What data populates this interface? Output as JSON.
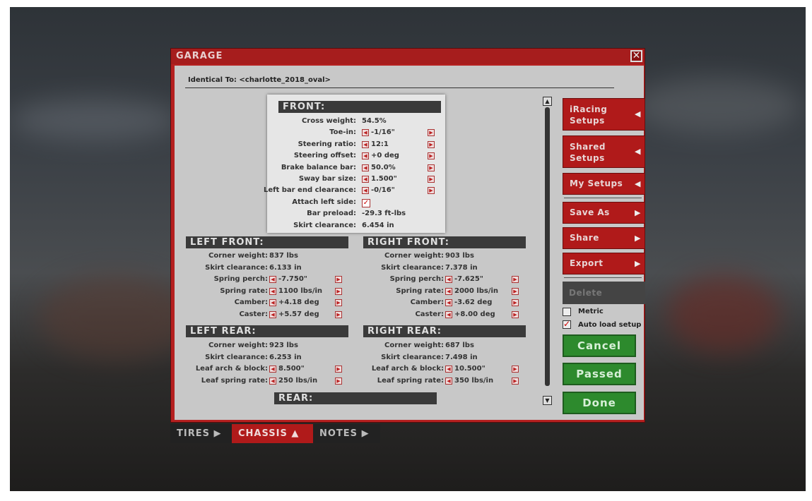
{
  "window": {
    "title": "GARAGE",
    "close_glyph": "✕"
  },
  "identical_to": "Identical To: <charlotte_2018_oval>",
  "front": {
    "header": "FRONT:",
    "rows": [
      {
        "label": "Cross weight:",
        "value": "54.5%",
        "adjustable": false
      },
      {
        "label": "Toe-in:",
        "value": "-1/16\"",
        "adjustable": true
      },
      {
        "label": "Steering ratio:",
        "value": "12:1",
        "adjustable": true
      },
      {
        "label": "Steering offset:",
        "value": "+0 deg",
        "adjustable": true
      },
      {
        "label": "Brake balance bar:",
        "value": "50.0%",
        "adjustable": true
      },
      {
        "label": "Sway bar size:",
        "value": "1.500\"",
        "adjustable": true
      },
      {
        "label": "Left bar end clearance:",
        "value": "-0/16\"",
        "adjustable": true
      },
      {
        "label": "Attach left side:",
        "value": "✓",
        "adjustable": false,
        "checkbox": true
      },
      {
        "label": "Bar preload:",
        "value": "-29.3 ft-lbs",
        "adjustable": false
      },
      {
        "label": "Skirt clearance:",
        "value": "6.454 in",
        "adjustable": false
      }
    ]
  },
  "left_front": {
    "header": "LEFT FRONT:",
    "rows": [
      {
        "label": "Corner weight:",
        "value": "837 lbs",
        "adjustable": false
      },
      {
        "label": "Skirt clearance:",
        "value": "6.133 in",
        "adjustable": false
      },
      {
        "label": "Spring perch:",
        "value": "-7.750\"",
        "adjustable": true
      },
      {
        "label": "Spring rate:",
        "value": "1100 lbs/in",
        "adjustable": true
      },
      {
        "label": "Camber:",
        "value": "+4.18 deg",
        "adjustable": true
      },
      {
        "label": "Caster:",
        "value": "+5.57 deg",
        "adjustable": true
      }
    ]
  },
  "right_front": {
    "header": "RIGHT FRONT:",
    "rows": [
      {
        "label": "Corner weight:",
        "value": "903 lbs",
        "adjustable": false
      },
      {
        "label": "Skirt clearance:",
        "value": "7.378 in",
        "adjustable": false
      },
      {
        "label": "Spring perch:",
        "value": "-7.625\"",
        "adjustable": true
      },
      {
        "label": "Spring rate:",
        "value": "2000 lbs/in",
        "adjustable": true
      },
      {
        "label": "Camber:",
        "value": "-3.62 deg",
        "adjustable": true
      },
      {
        "label": "Caster:",
        "value": "+8.00 deg",
        "adjustable": true
      }
    ]
  },
  "left_rear": {
    "header": "LEFT REAR:",
    "rows": [
      {
        "label": "Corner weight:",
        "value": "923 lbs",
        "adjustable": false
      },
      {
        "label": "Skirt clearance:",
        "value": "6.253 in",
        "adjustable": false
      },
      {
        "label": "Leaf arch & block:",
        "value": "8.500\"",
        "adjustable": true
      },
      {
        "label": "Leaf spring rate:",
        "value": "250 lbs/in",
        "adjustable": true
      }
    ]
  },
  "right_rear": {
    "header": "RIGHT REAR:",
    "rows": [
      {
        "label": "Corner weight:",
        "value": "687 lbs",
        "adjustable": false
      },
      {
        "label": "Skirt clearance:",
        "value": "7.498 in",
        "adjustable": false
      },
      {
        "label": "Leaf arch & block:",
        "value": "10.500\"",
        "adjustable": true
      },
      {
        "label": "Leaf spring rate:",
        "value": "350 lbs/in",
        "adjustable": true
      }
    ]
  },
  "rear": {
    "header": "REAR:"
  },
  "side_buttons": {
    "iracing_setups": "iRacing Setups",
    "shared_setups": "Shared Setups",
    "my_setups": "My Setups",
    "save_as": "Save As",
    "share": "Share",
    "export": "Export",
    "delete": "Delete"
  },
  "options": {
    "metric": "Metric",
    "metric_checked": false,
    "auto_load": "Auto load setup",
    "auto_load_checked": true
  },
  "actions": {
    "cancel": "Cancel",
    "passed": "Passed",
    "done": "Done"
  },
  "tabs": [
    {
      "label": "TIRES ▶",
      "active": false
    },
    {
      "label": "CHASSIS ▲",
      "active": true
    },
    {
      "label": "NOTES ▶",
      "active": false
    }
  ],
  "colors": {
    "accent": "#b01a1a",
    "panel": "#c8c8c8",
    "go": "#2d8a2d"
  }
}
